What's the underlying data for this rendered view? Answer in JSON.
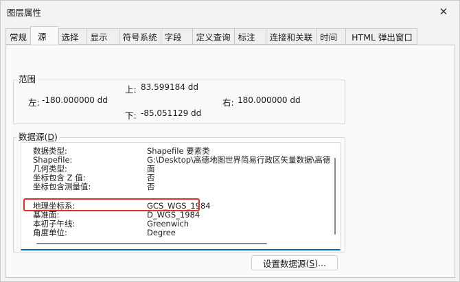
{
  "window": {
    "title": "图层属性",
    "close_glyph": "✕"
  },
  "tabs": [
    {
      "label": "常规",
      "active": false
    },
    {
      "label": "源",
      "active": true
    },
    {
      "label": "选择",
      "active": false
    },
    {
      "label": "显示",
      "active": false
    },
    {
      "label": "符号系统",
      "active": false
    },
    {
      "label": "字段",
      "active": false
    },
    {
      "label": "定义查询",
      "active": false
    },
    {
      "label": "标注",
      "active": false
    },
    {
      "label": "连接和关联",
      "active": false
    },
    {
      "label": "时间",
      "active": false
    },
    {
      "label": "HTML 弹出窗口",
      "active": false
    }
  ],
  "extent": {
    "label": "范围",
    "top_label": "上:",
    "top_value": "83.599184 dd",
    "left_label": "左:",
    "left_value": "-180.000000 dd",
    "right_label": "右:",
    "right_value": "180.000000 dd",
    "bottom_label": "下:",
    "bottom_value": "-85.051129 dd"
  },
  "datasource": {
    "label": "数据源",
    "accelerator": "D",
    "rows": [
      {
        "key": "数据类型:",
        "value": "Shapefile 要素类"
      },
      {
        "key": "Shapefile:",
        "value": "G:\\Desktop\\高德地图世界简易行政区矢量数据\\高德"
      },
      {
        "key": "几何类型:",
        "value": "面"
      },
      {
        "key": "坐标包含 Z 值:",
        "value": "否"
      },
      {
        "key": "坐标包含测量值:",
        "value": "否"
      },
      {
        "key": "",
        "value": ""
      },
      {
        "key": "地理坐标系:",
        "value": "GCS_WGS_1984"
      },
      {
        "key": "基准面:",
        "value": "D_WGS_1984"
      },
      {
        "key": "本初子午线:",
        "value": "Greenwich"
      },
      {
        "key": "角度单位:",
        "value": "Degree"
      }
    ]
  },
  "set_source_button": {
    "label": "设置数据源",
    "accelerator": "S",
    "suffix": "..."
  },
  "colors": {
    "accent": "#0067c0",
    "highlight": "#e0302a"
  }
}
